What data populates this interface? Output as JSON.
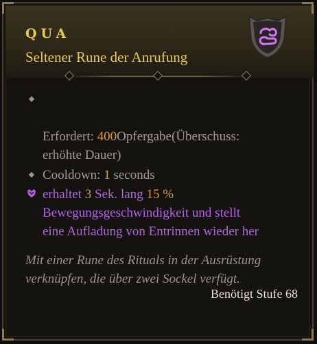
{
  "item": {
    "name": "QUA",
    "type": "Seltener Rune der Anrufung",
    "rune_symbol_icon": "rune-emblem-icon",
    "colors": {
      "name": "#e8c95a",
      "value": "#d79a3c",
      "effect": "#b165e6"
    }
  },
  "stats": {
    "requirement": {
      "label": "Erfordert:",
      "value": "400",
      "rest": "Opfergabe(Überschuss:",
      "line2": "erhöhte Dauer)"
    },
    "cooldown": {
      "label": "Cooldown:",
      "value": "1",
      "unit": "seconds"
    },
    "effect": {
      "prefix": "erhaltet",
      "value1": "3",
      "mid": "Sek. lang",
      "value2": "15 %",
      "line2": "Bewegungsgeschwindigkeit und stellt",
      "line3": "eine Aufladung von Entrinnen wieder her"
    }
  },
  "flavor": {
    "line1": "Mit einer Rune des Rituals in der Ausrüstung",
    "line2": "verknüpfen, die über zwei Sockel verfügt."
  },
  "required_level": "Benötigt Stufe 68"
}
